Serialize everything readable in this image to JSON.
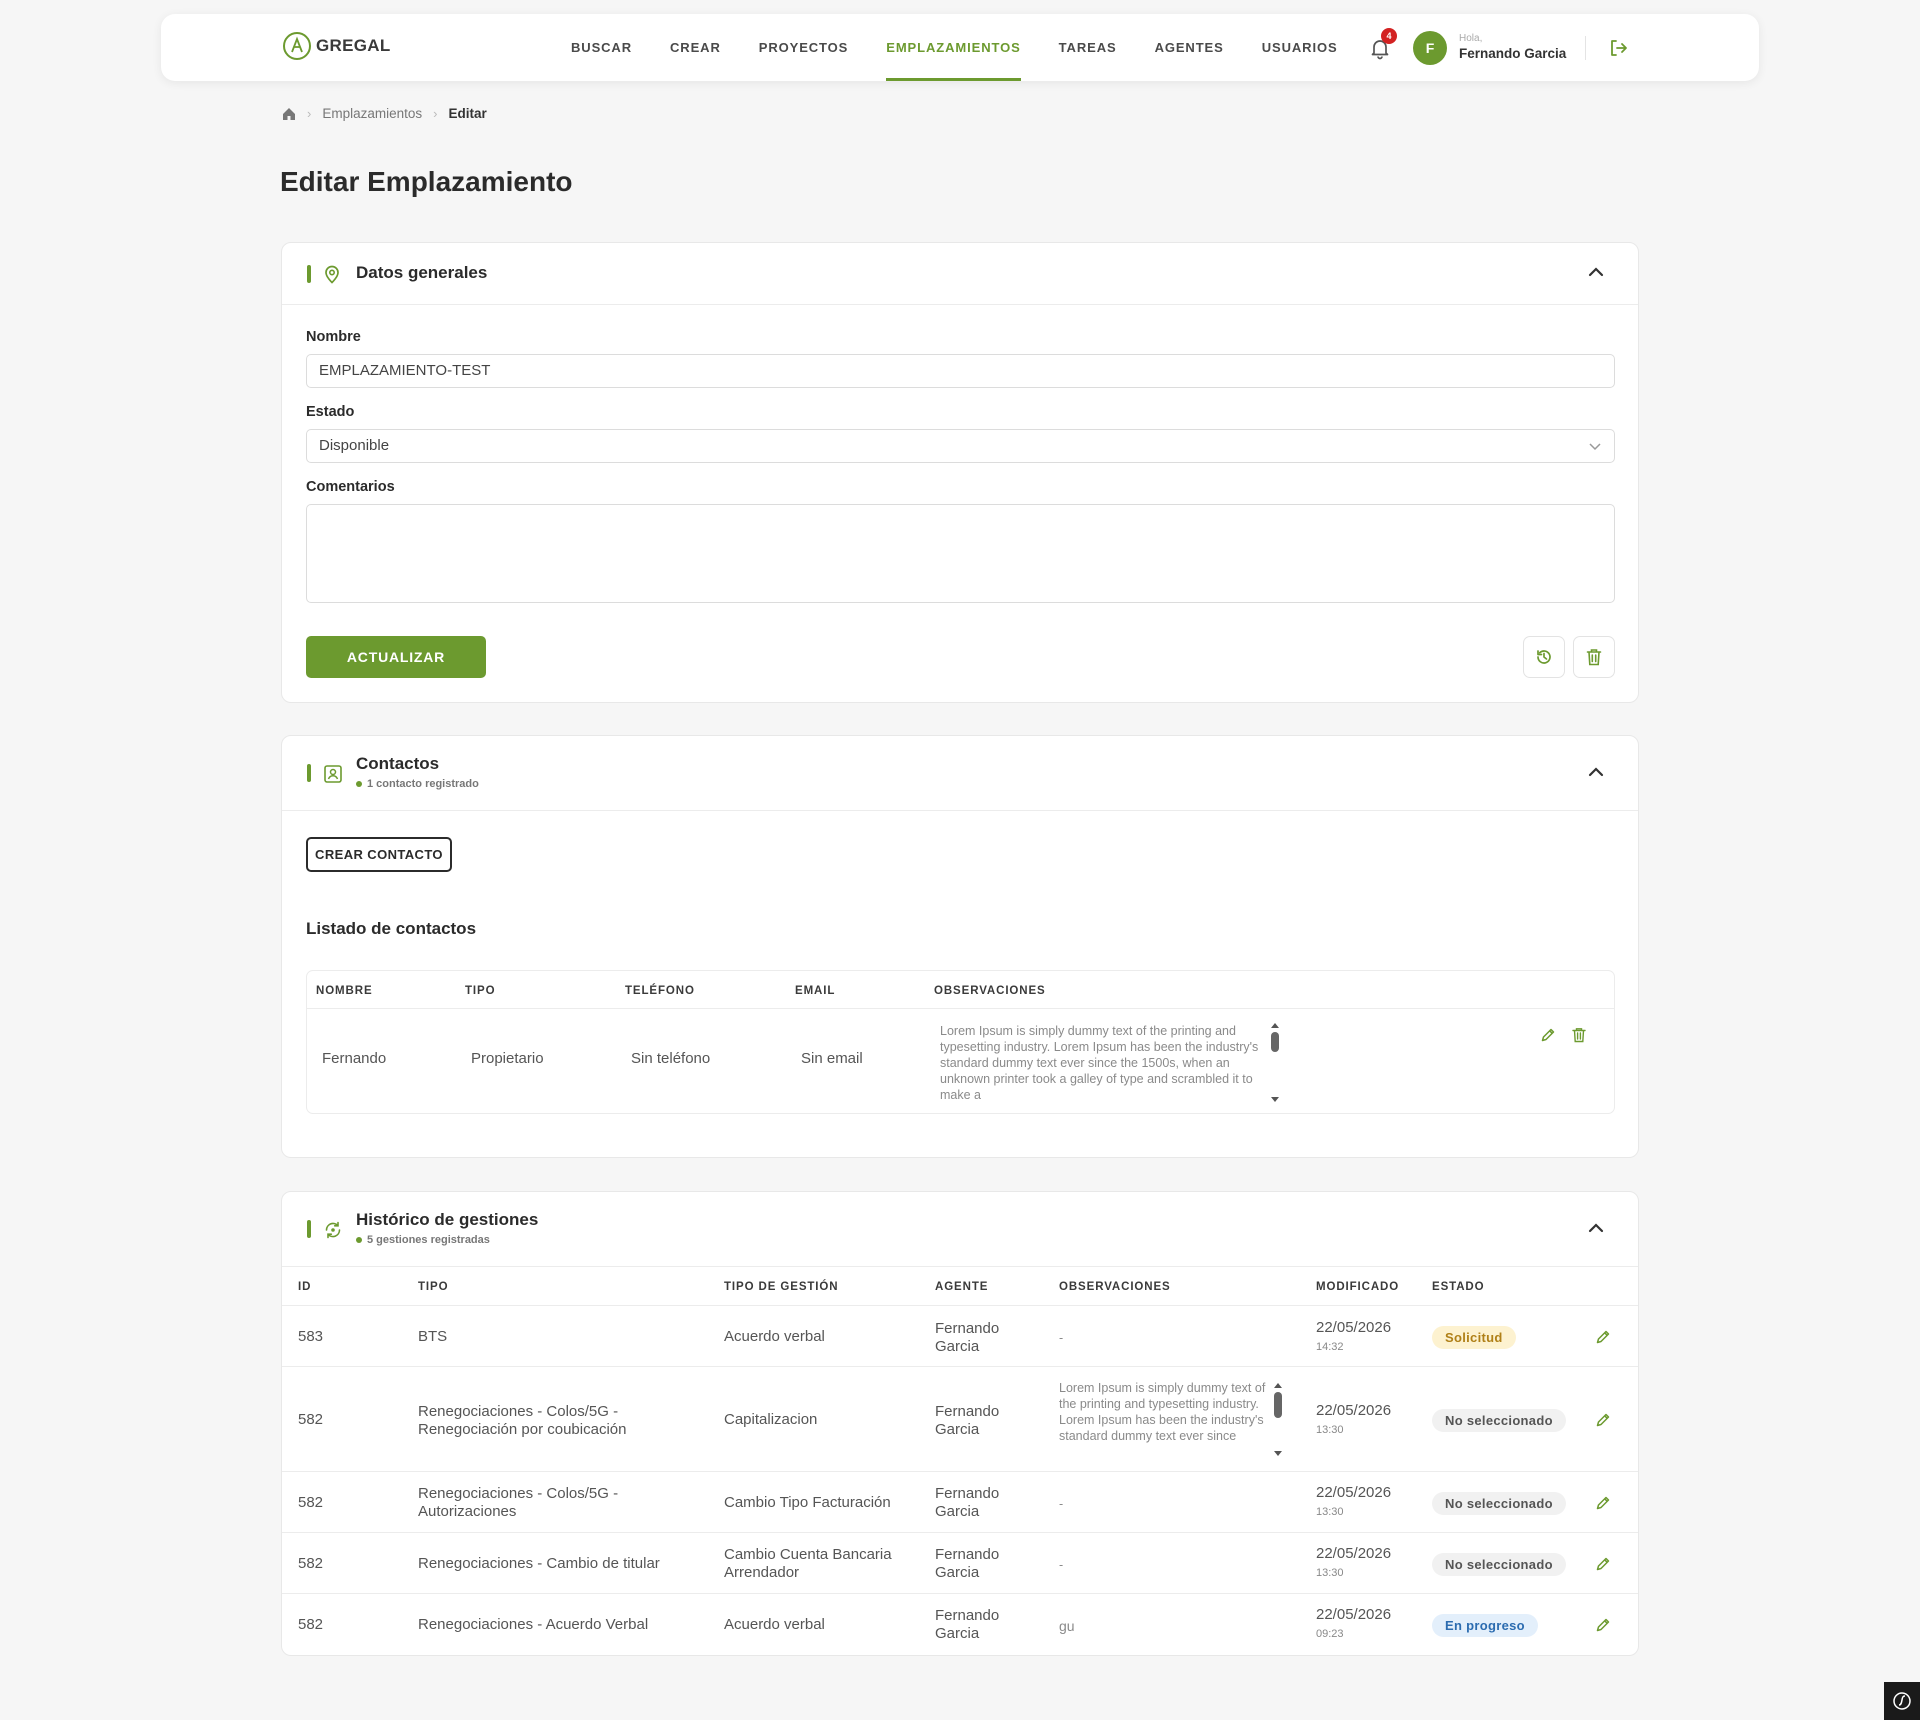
{
  "nav": {
    "logo_text": "GREGAL",
    "items": [
      "BUSCAR",
      "CREAR",
      "PROYECTOS",
      "EMPLAZAMIENTOS",
      "TAREAS",
      "AGENTES",
      "USUARIOS"
    ],
    "active_item": "EMPLAZAMIENTOS",
    "notification_count": "4",
    "greeting": "Hola,",
    "user_name": "Fernando Garcia",
    "avatar_initial": "F"
  },
  "breadcrumb": {
    "section": "Emplazamientos",
    "current": "Editar"
  },
  "page_title": "Editar Emplazamiento",
  "general": {
    "title": "Datos generales",
    "nombre_label": "Nombre",
    "nombre_value": "EMPLAZAMIENTO-TEST",
    "estado_label": "Estado",
    "estado_value": "Disponible",
    "comentarios_label": "Comentarios",
    "comentarios_value": "",
    "update_label": "ACTUALIZAR"
  },
  "contacts": {
    "title": "Contactos",
    "subtitle": "1 contacto registrado",
    "create_label": "CREAR CONTACTO",
    "list_title": "Listado de contactos",
    "columns": [
      "NOMBRE",
      "TIPO",
      "TELÉFONO",
      "EMAIL",
      "OBSERVACIONES"
    ],
    "rows": [
      {
        "nombre": "Fernando",
        "tipo": "Propietario",
        "telefono": "Sin teléfono",
        "email": "Sin email",
        "observaciones": "Lorem Ipsum is simply dummy text of the printing and typesetting industry. Lorem Ipsum has been the industry's standard dummy text ever since the 1500s, when an unknown printer took a galley of type and scrambled it to make a"
      }
    ]
  },
  "history": {
    "title": "Histórico de gestiones",
    "subtitle": "5 gestiones registradas",
    "columns": [
      "ID",
      "TIPO",
      "TIPO DE GESTIÓN",
      "AGENTE",
      "OBSERVACIONES",
      "MODIFICADO",
      "ESTADO"
    ],
    "rows": [
      {
        "id": "583",
        "tipo": "BTS",
        "gestion": "Acuerdo verbal",
        "agente": "Fernando Garcia",
        "obs": "-",
        "fecha": "22/05/2026",
        "hora": "14:32",
        "estado": "Solicitud"
      },
      {
        "id": "582",
        "tipo": "Renegociaciones - Colos/5G - Renegociación por coubicación",
        "gestion": "Capitalizacion",
        "agente": "Fernando Garcia",
        "obs": "Lorem Ipsum is simply dummy text of the printing and typesetting industry. Lorem Ipsum has been the industry's standard dummy text ever since",
        "fecha": "22/05/2026",
        "hora": "13:30",
        "estado": "No seleccionado"
      },
      {
        "id": "582",
        "tipo": "Renegociaciones - Colos/5G - Autorizaciones",
        "gestion": "Cambio Tipo Facturación",
        "agente": "Fernando Garcia",
        "obs": "-",
        "fecha": "22/05/2026",
        "hora": "13:30",
        "estado": "No seleccionado"
      },
      {
        "id": "582",
        "tipo": "Renegociaciones - Cambio de titular",
        "gestion": "Cambio Cuenta Bancaria Arrendador",
        "agente": "Fernando Garcia",
        "obs": "-",
        "fecha": "22/05/2026",
        "hora": "13:30",
        "estado": "No seleccionado"
      },
      {
        "id": "582",
        "tipo": "Renegociaciones - Acuerdo Verbal",
        "gestion": "Acuerdo verbal",
        "agente": "Fernando Garcia",
        "obs": "gu",
        "fecha": "22/05/2026",
        "hora": "09:23",
        "estado": "En progreso"
      }
    ]
  },
  "colors": {
    "accent": "#6c9a2f",
    "badge": "#d32222",
    "pill_solicitud": "#fdf2d0",
    "pill_progreso": "#e3effb"
  }
}
